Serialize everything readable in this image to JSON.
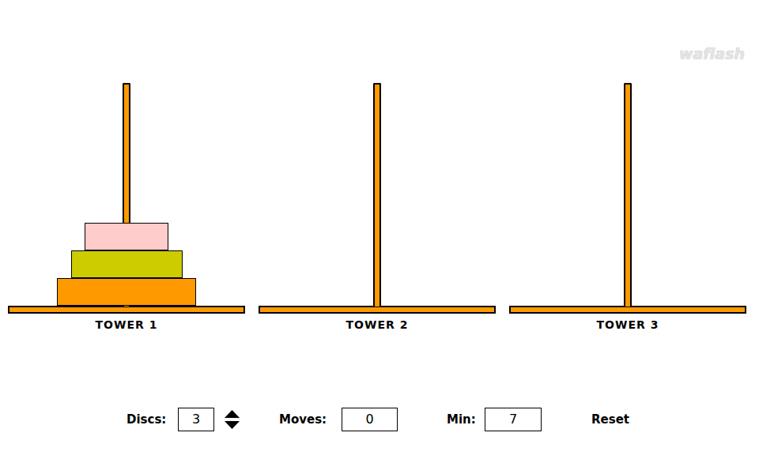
{
  "watermark": "waflash",
  "towers": [
    {
      "label": "TOWER 1",
      "discs": [
        {
          "size": 3,
          "color": "#FF9900"
        },
        {
          "size": 2,
          "color": "#CCCC00"
        },
        {
          "size": 1,
          "color": "#FFCCCC"
        }
      ]
    },
    {
      "label": "TOWER 2",
      "discs": []
    },
    {
      "label": "TOWER 3",
      "discs": []
    }
  ],
  "controls": {
    "discs": {
      "label": "Discs:",
      "value": "3"
    },
    "moves": {
      "label": "Moves:",
      "value": "0"
    },
    "min": {
      "label": "Min:",
      "value": "7"
    },
    "reset": "Reset"
  }
}
